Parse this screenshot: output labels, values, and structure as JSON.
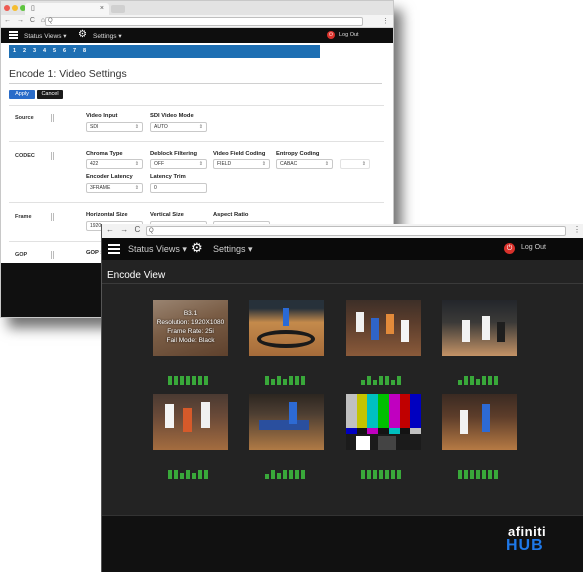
{
  "settings_window": {
    "browser": {
      "tab_close": "×",
      "address": "Q",
      "nav": "← → C ⌂",
      "menu": "⋮"
    },
    "nav": {
      "status_views": "Status Views",
      "settings": "Settings",
      "dropdown_caret": "▾",
      "logout": "Log Out"
    },
    "channel_tabs": [
      "1",
      "2",
      "3",
      "4",
      "5",
      "6",
      "7",
      "8"
    ],
    "title": "Encode 1: Video Settings",
    "buttons": {
      "apply": "Apply",
      "cancel": "Cancel"
    },
    "sections": {
      "source": "Source",
      "codec": "CODEC",
      "frame": "Frame",
      "gop": "GOP"
    },
    "fields": {
      "video_input": {
        "label": "Video Input",
        "value": "SDI"
      },
      "sdi_video_mode": {
        "label": "SDI Video Mode",
        "value": "AUTO"
      },
      "chroma_type": {
        "label": "Chroma Type",
        "value": "422"
      },
      "deblock_filtering": {
        "label": "Deblock Filtering",
        "value": "OFF"
      },
      "video_field_coding": {
        "label": "Video Field Coding",
        "value": "FIELD"
      },
      "entropy_coding": {
        "label": "Entropy Coding",
        "value": "CABAC"
      },
      "encoder_latency": {
        "label": "Encoder Latency",
        "value": "3FRAME"
      },
      "latency_trim": {
        "label": "Latency Trim",
        "value": "0"
      },
      "horizontal_size": {
        "label": "Horizontal Size",
        "value": "1920"
      },
      "vertical_size": {
        "label": "Vertical Size",
        "value": ""
      },
      "aspect_ratio": {
        "label": "Aspect Ratio",
        "value": ""
      },
      "gop_size": {
        "label": "GOP S",
        "value": ""
      }
    }
  },
  "encode_window": {
    "browser": {
      "nav": "← → C ⌂",
      "address": "Q",
      "menu": "⋮"
    },
    "nav": {
      "status_views": "Status Views",
      "settings": "Settings",
      "dropdown_caret": "▾",
      "logout": "Log Out"
    },
    "title": "Encode View",
    "overlay": [
      "B3.1",
      "Resolution: 1920X1080",
      "Frame Rate: 25i",
      "Fail Mode: Black"
    ],
    "meter_levels": [
      [
        0.9,
        0.9,
        0.9,
        0.9,
        0.9,
        0.9,
        0.9
      ],
      [
        0.85,
        0.55,
        0.85,
        0.55,
        0.85,
        0.85,
        0.85
      ],
      [
        0.5,
        0.85,
        0.45,
        0.85,
        0.85,
        0.5,
        0.85
      ],
      [
        0.5,
        0.85,
        0.85,
        0.55,
        0.85,
        0.85,
        0.85
      ],
      [
        0.9,
        0.9,
        0.6,
        0.9,
        0.6,
        0.9,
        0.9
      ],
      [
        0.5,
        0.9,
        0.6,
        0.9,
        0.9,
        0.9,
        0.9
      ],
      [
        0.9,
        0.9,
        0.9,
        0.9,
        0.9,
        0.9,
        0.9
      ],
      [
        0.9,
        0.9,
        0.9,
        0.9,
        0.9,
        0.9,
        0.9
      ]
    ],
    "brand": {
      "top": "afiniti",
      "bottom": "HUB"
    },
    "colors": {
      "accent_blue": "#1e78e8",
      "meter_green": "#39a83a",
      "nav_blue": "#1e6fb3",
      "alert_red": "#d9312b"
    }
  }
}
